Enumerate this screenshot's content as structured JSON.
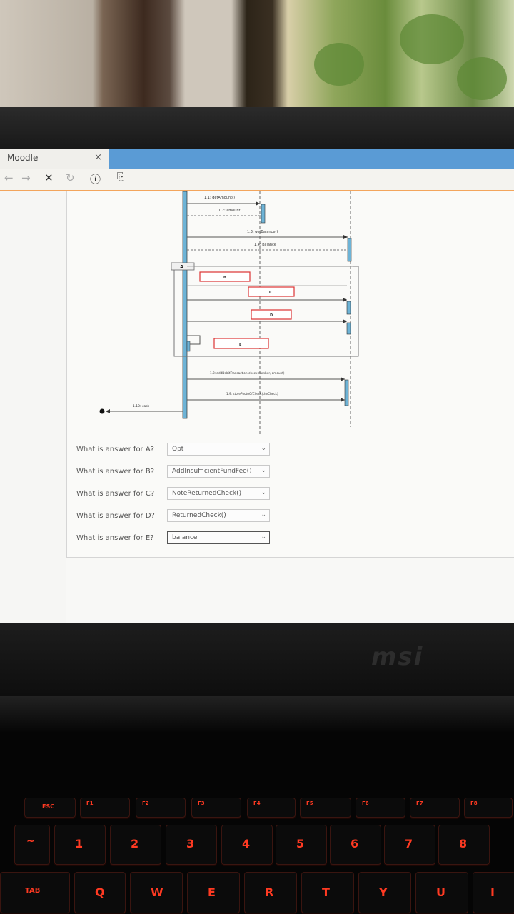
{
  "browser": {
    "tab_title": "Moodle",
    "tab_close": "×",
    "nav": {
      "back": "←",
      "forward": "→",
      "stop": "✕",
      "reload": "↻",
      "info": "ⓘ",
      "page": "⎘"
    }
  },
  "diagram": {
    "messages": [
      "1.1: getAmount()",
      "1.2: amount",
      "1.3: getBalance()",
      "1.4: balance",
      "1.8: addDebitTransaction(check number, amount)",
      "1.9: storePhotoOfCheck(theCheck)",
      "1.10: cash"
    ],
    "fragment_label": "A",
    "blanks": [
      "B",
      "C",
      "D",
      "E"
    ]
  },
  "questions": [
    {
      "label": "What is answer for A?",
      "value": "Opt"
    },
    {
      "label": "What is answer for B?",
      "value": "AddInsufficientFundFee()"
    },
    {
      "label": "What is answer for C?",
      "value": "NoteReturnedCheck()"
    },
    {
      "label": "What is answer for D?",
      "value": "ReturnedCheck()"
    },
    {
      "label": "What is answer for E?",
      "value": "balance"
    }
  ],
  "laptop": {
    "brand": "msi"
  },
  "keyboard": {
    "row1": [
      "ESC",
      "F1",
      "F2",
      "F3",
      "F4",
      "F5",
      "F6",
      "F7",
      "F8"
    ],
    "row2": [
      "~",
      "1",
      "2",
      "3",
      "4",
      "5",
      "6",
      "7",
      "8"
    ],
    "row3": [
      "TAB",
      "Q",
      "W",
      "E",
      "R",
      "T",
      "Y",
      "U",
      "I"
    ]
  }
}
